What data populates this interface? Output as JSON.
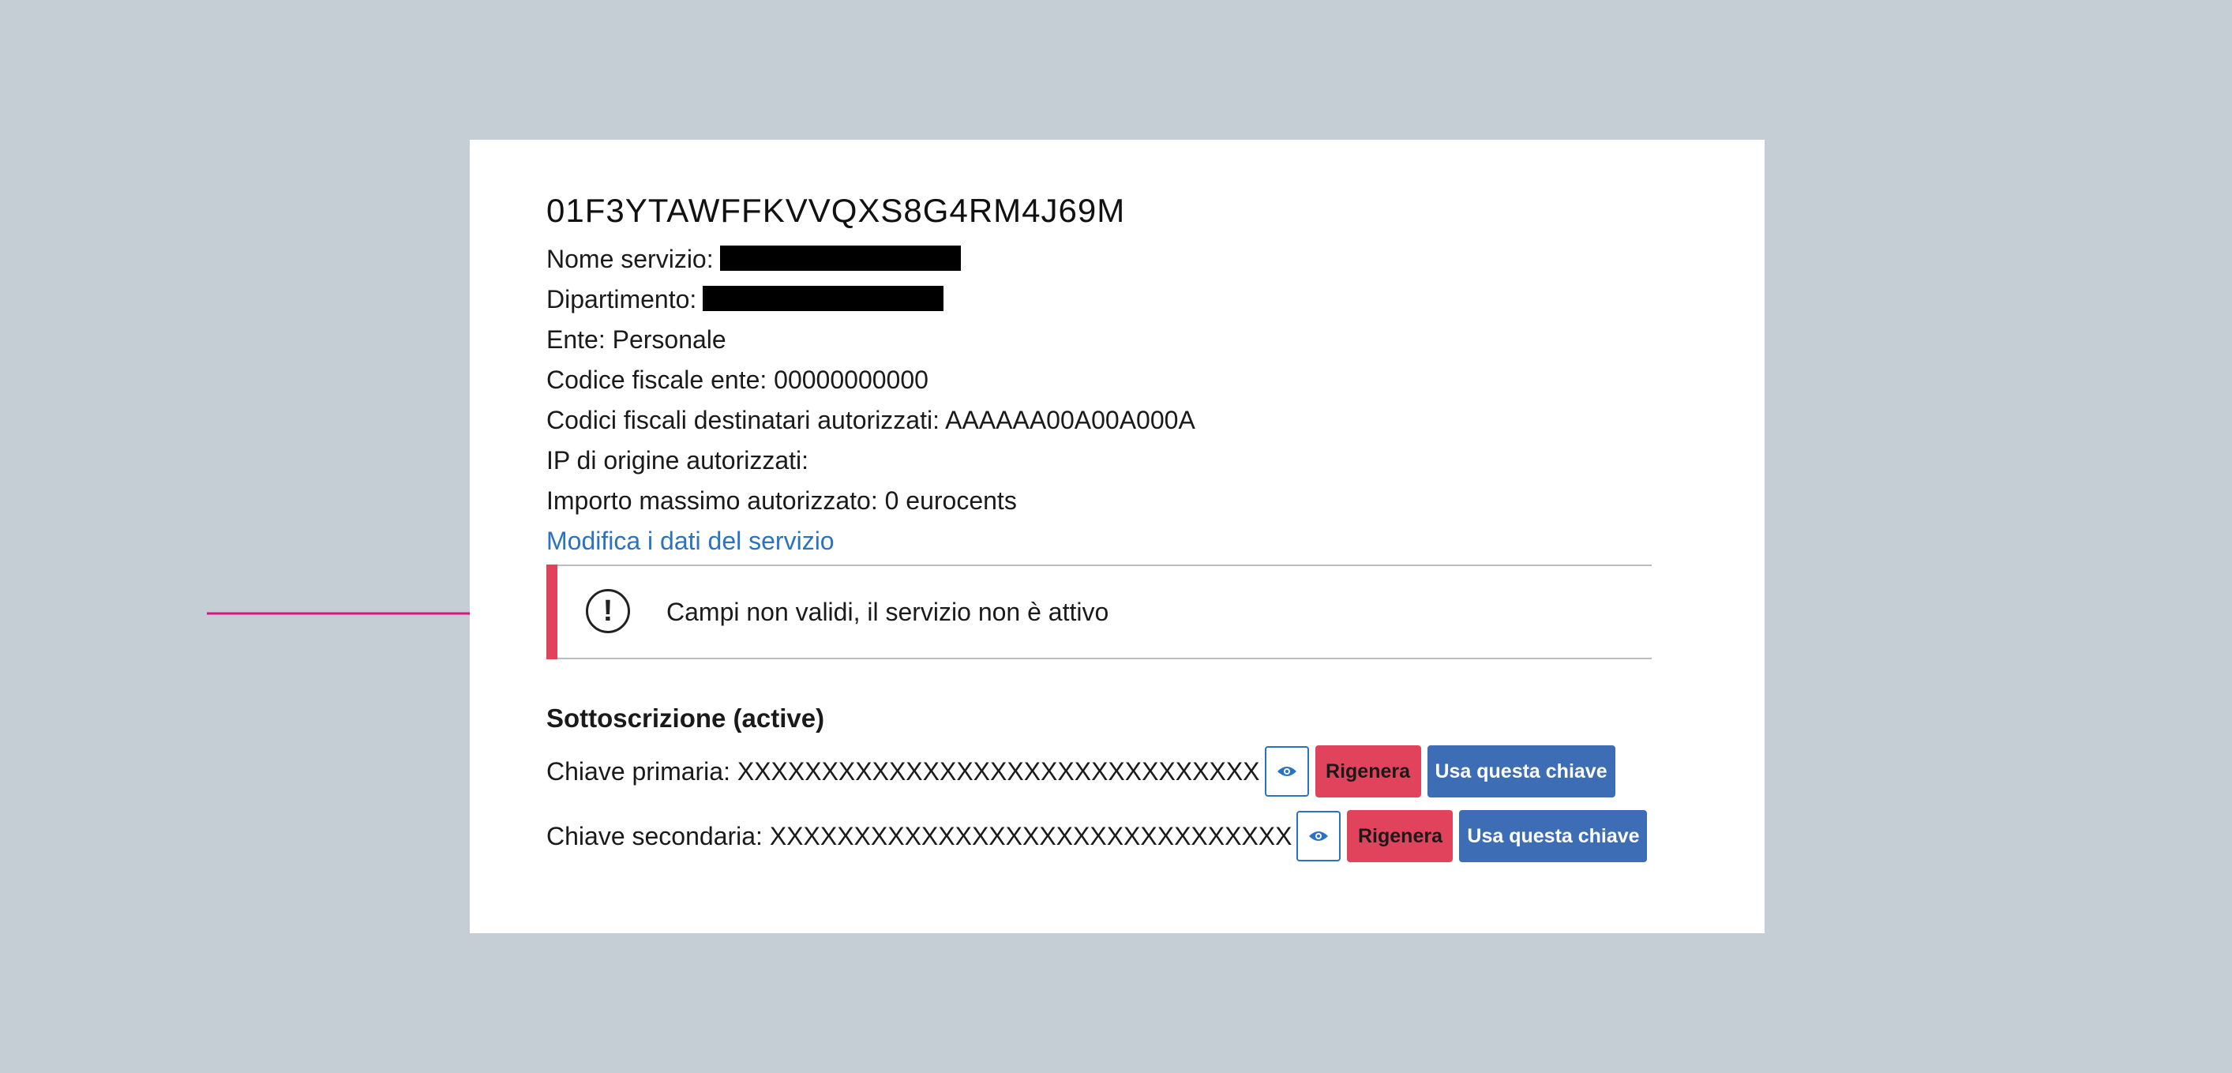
{
  "service": {
    "id": "01F3YTAWFFKVVQXS8G4RM4J69M",
    "name_label": "Nome servizio:",
    "department_label": "Dipartimento:",
    "entity_line": "Ente: Personale",
    "fiscal_code_line": "Codice fiscale ente: 00000000000",
    "authorized_recipients_line": "Codici fiscali destinatari autorizzati: AAAAAA00A00A000A",
    "authorized_ips_line": "IP di origine autorizzati:",
    "max_amount_line": "Importo massimo autorizzato: 0 eurocents",
    "edit_link": "Modifica i dati del servizio"
  },
  "alert": {
    "text": "Campi non validi, il servizio non è attivo",
    "icon": "exclamation-circle-icon",
    "color": "#e2435c"
  },
  "subscription": {
    "title": "Sottoscrizione (active)",
    "primary": {
      "label": "Chiave primaria: XXXXXXXXXXXXXXXXXXXXXXXXXXXXXXX",
      "regenerate": "Rigenera",
      "use": "Usa questa chiave"
    },
    "secondary": {
      "label": "Chiave secondaria: XXXXXXXXXXXXXXXXXXXXXXXXXXXXXXX",
      "regenerate": "Rigenera",
      "use": "Usa questa chiave"
    }
  },
  "colors": {
    "background": "#c5ced5",
    "accent_red": "#e2435c",
    "accent_blue": "#3d6eb5",
    "link": "#2a73c1",
    "annotation_arrow": "#d9157f"
  }
}
